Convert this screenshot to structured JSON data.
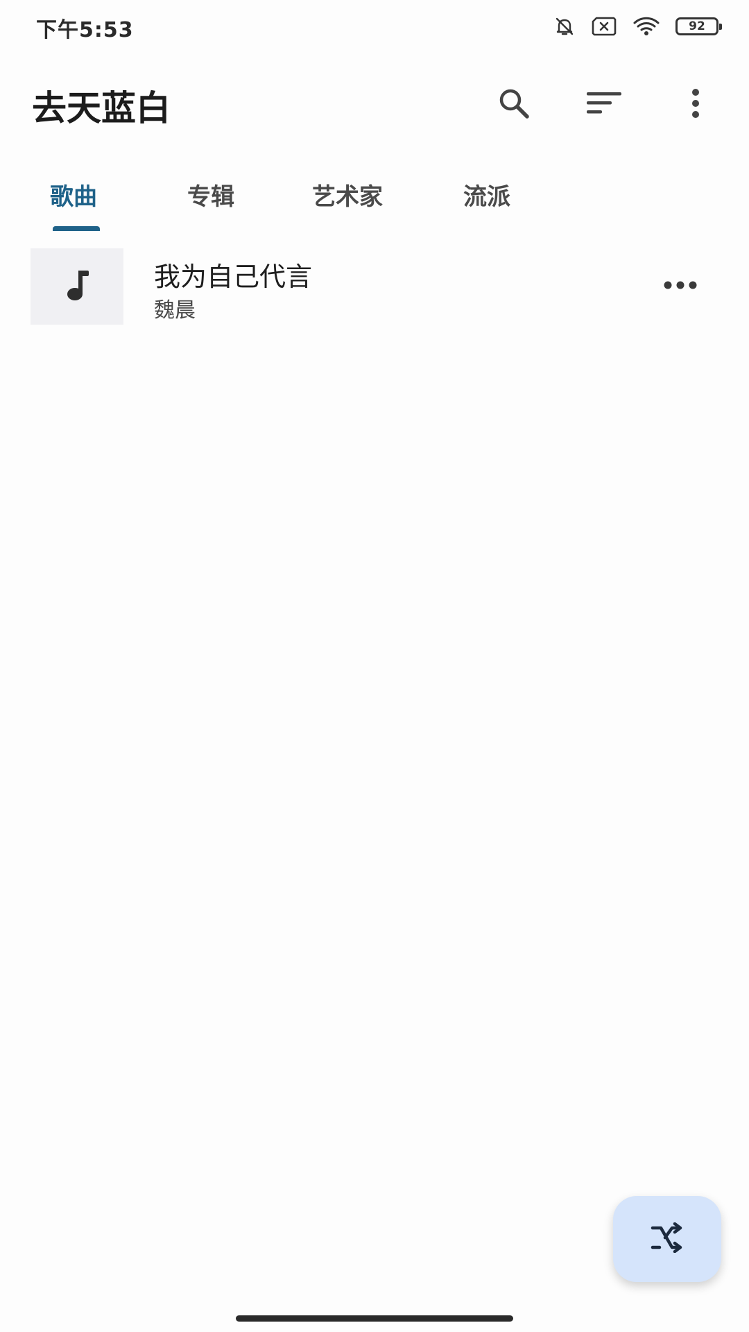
{
  "status_bar": {
    "time": "下午5:53",
    "battery_level": "92",
    "icons": [
      "bell-muted-icon",
      "sim-disabled-icon",
      "wifi-icon",
      "battery-icon"
    ]
  },
  "app_bar": {
    "title": "去天蓝白",
    "actions": [
      "search-icon",
      "sort-icon",
      "more-vertical-icon"
    ]
  },
  "tabs": {
    "items": [
      {
        "label": "歌曲",
        "active": true
      },
      {
        "label": "专辑",
        "active": false
      },
      {
        "label": "艺术家",
        "active": false
      },
      {
        "label": "流派",
        "active": false
      }
    ]
  },
  "songs": [
    {
      "title": "我为自己代言",
      "artist": "魏晨",
      "thumbnail_icon": "music-note-icon",
      "action_icon": "more-horizontal-icon"
    }
  ],
  "fab": {
    "icon": "shuffle-icon"
  },
  "colors": {
    "accent": "#1f6289",
    "fab_background": "#d5e4fb",
    "thumbnail_background": "#f0f0f3",
    "background": "#fdfdfd"
  }
}
